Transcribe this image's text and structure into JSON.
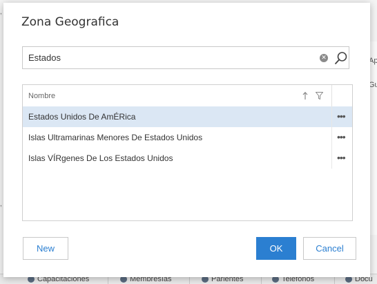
{
  "dialog": {
    "title": "Zona Geografica",
    "search": {
      "value": "Estados",
      "placeholder": ""
    },
    "grid": {
      "column_header": "Nombre",
      "rows": [
        {
          "label": "Estados Unidos De AmÉRica",
          "selected": true
        },
        {
          "label": "Islas Ultramarinas Menores De Estados Unidos",
          "selected": false
        },
        {
          "label": "Islas VÍRgenes De Los Estados Unidos",
          "selected": false
        }
      ],
      "row_action_glyph": "•••"
    },
    "buttons": {
      "new": "New",
      "ok": "OK",
      "cancel": "Cancel"
    }
  },
  "background": {
    "right_fragments": [
      "Ap",
      "Gu"
    ],
    "bottom_tabs": [
      "Capacitaciones",
      "Membresías",
      "Parientes",
      "Teléfonos",
      "Docu"
    ]
  },
  "colors": {
    "accent": "#2b7fd1",
    "selected_row": "#dbe7f4"
  },
  "icons": [
    "clear-icon",
    "search-icon",
    "sort-up-icon",
    "filter-icon",
    "more-icon"
  ]
}
